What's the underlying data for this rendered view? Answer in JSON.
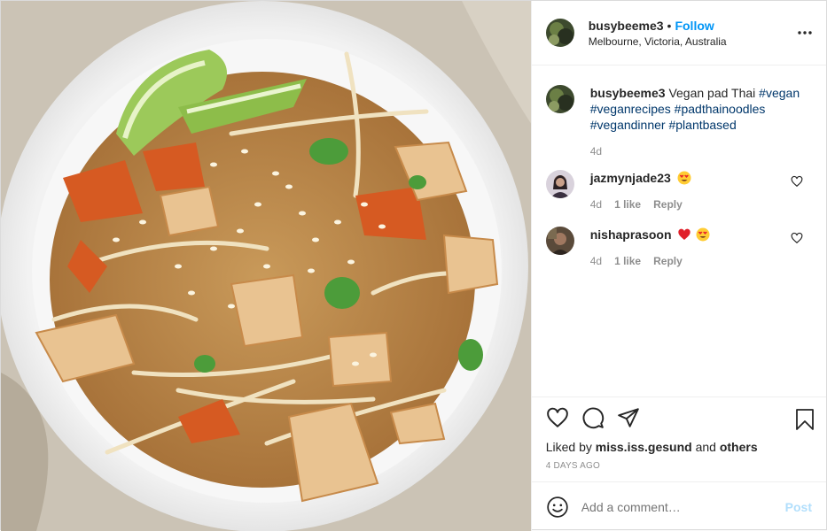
{
  "post": {
    "author": "busybeeme3",
    "follow_label": "Follow",
    "separator": "•",
    "location": "Melbourne, Victoria, Australia",
    "more_icon": "more-options-icon",
    "image_desc": "vegan-pad-thai-bowl"
  },
  "caption": {
    "username": "busybeeme3",
    "text": "Vegan pad Thai",
    "hashtags": [
      "#vegan",
      "#veganrecipes",
      "#padthainoodles",
      "#vegandinner",
      "#plantbased"
    ],
    "time": "4d"
  },
  "comments": [
    {
      "username": "jazmynjade23",
      "emoji": [
        "heart-eyes-emoji"
      ],
      "time": "4d",
      "likes": "1 like",
      "reply": "Reply"
    },
    {
      "username": "nishaprasoon",
      "emoji": [
        "red-heart-emoji",
        "heart-eyes-emoji"
      ],
      "time": "4d",
      "likes": "1 like",
      "reply": "Reply"
    }
  ],
  "actions": {
    "liked_prefix": "Liked by",
    "liked_user": "miss.iss.gesund",
    "liked_and": "and",
    "liked_others": "others",
    "posted_ago": "4 DAYS AGO"
  },
  "add_comment": {
    "placeholder": "Add a comment…",
    "post_label": "Post"
  },
  "colors": {
    "link": "#0095f6",
    "hashtag": "#00376b",
    "muted": "#8e8e8e",
    "post_disabled": "#b2dffc"
  }
}
